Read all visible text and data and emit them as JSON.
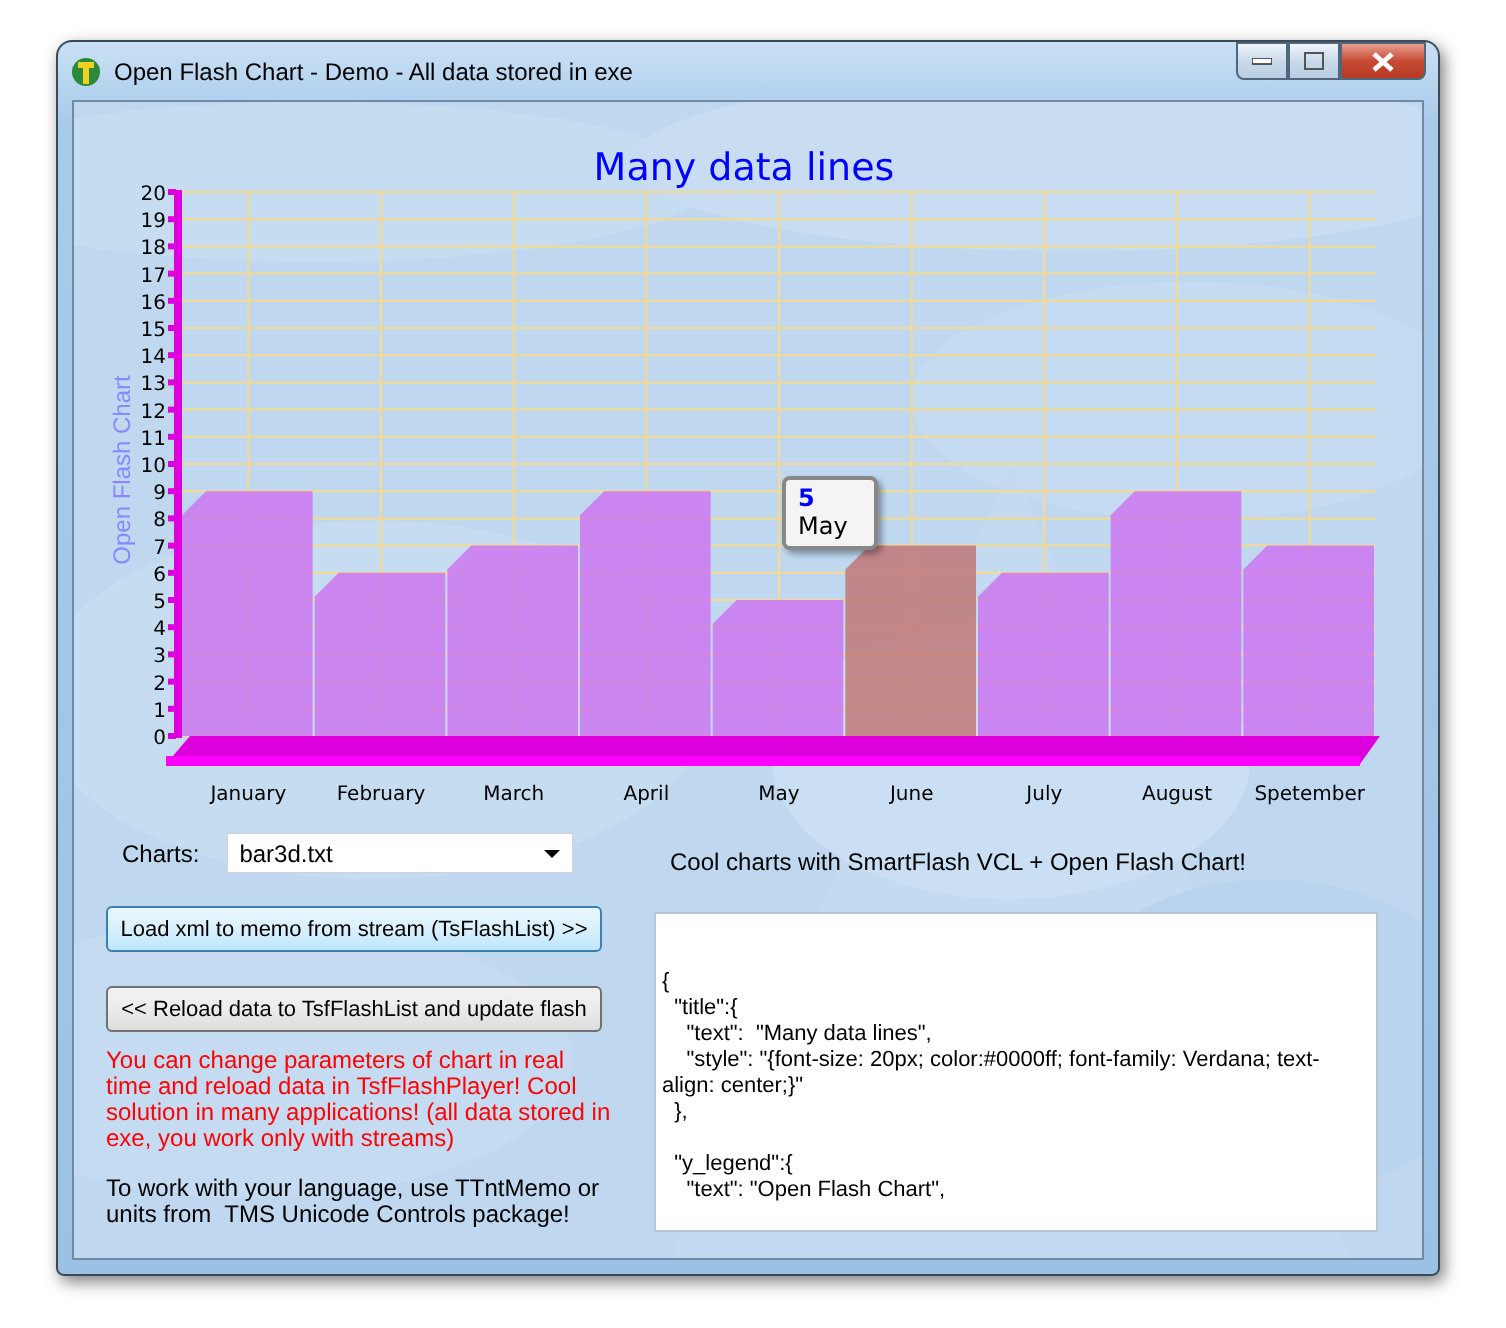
{
  "window": {
    "title": "Open Flash Chart - Demo - All data stored in exe"
  },
  "chart": {
    "chart_data": {
      "type": "bar",
      "title": "Many data lines",
      "ylabel": "Open Flash Chart",
      "categories": [
        "January",
        "February",
        "March",
        "April",
        "May",
        "June",
        "July",
        "August",
        "Spetember"
      ],
      "series": [
        {
          "color": "#cc77f0",
          "values": [
            9,
            6,
            7,
            9,
            5,
            null,
            6,
            9,
            7
          ]
        },
        {
          "color": "#c07878",
          "values": [
            null,
            null,
            null,
            null,
            null,
            7,
            null,
            null,
            null
          ]
        }
      ],
      "ylim": [
        0,
        20
      ],
      "yticks": [
        0,
        1,
        2,
        3,
        4,
        5,
        6,
        7,
        8,
        9,
        10,
        11,
        12,
        13,
        14,
        15,
        16,
        17,
        18,
        19,
        20
      ],
      "grid": true
    },
    "tooltip": {
      "value": "5",
      "label": "May"
    }
  },
  "charts_field": {
    "label": "Charts:",
    "value": "bar3d.txt"
  },
  "buttons": [
    "Load xml to memo from stream (TsFlashList)  >>",
    "<< Reload data to TsfFlashList and update flash"
  ],
  "notice": "You can change parameters of chart in real time and reload data in TsfFlashPlayer! Cool solution in many applications! (all data stored in exe, you work only with streams)",
  "hint": "To work with your language, use TTntMemo or units from  TMS Unicode Controls package!",
  "caption": "Cool charts with SmartFlash VCL + Open Flash Chart!",
  "memo": {
    "blocks": [
      [
        "{",
        "  \"title\":{",
        "    \"text\":  \"Many data lines\",",
        "    \"style\": \"{font-size: 20px; color:#0000ff; font-family: Verdana; text-align: center;}\"",
        "  },"
      ],
      [
        "  \"y_legend\":{",
        "    \"text\": \"Open Flash Chart\","
      ]
    ]
  }
}
